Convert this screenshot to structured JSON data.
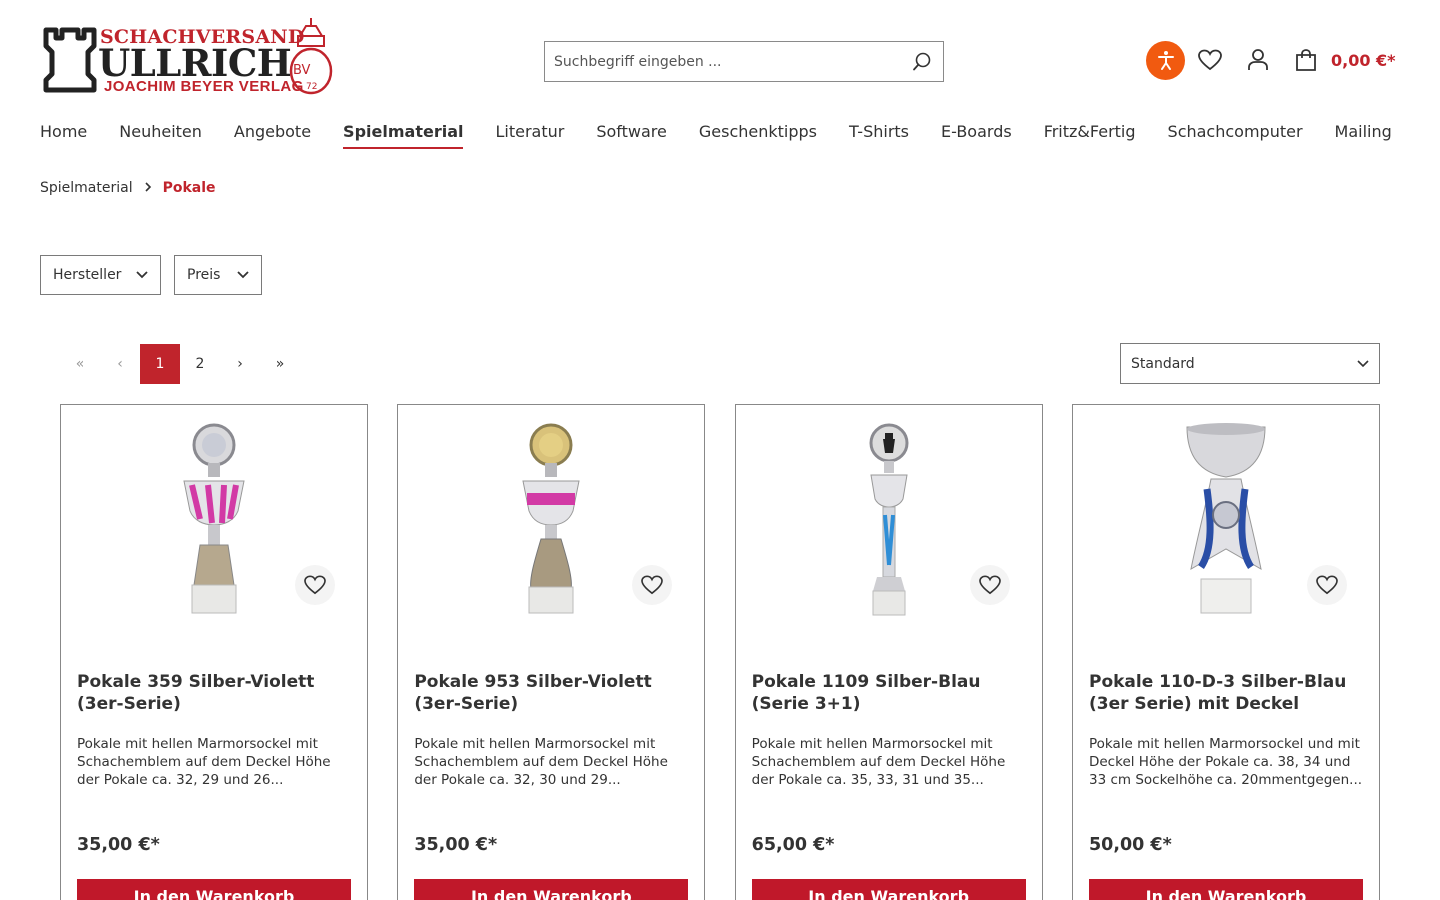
{
  "logo": {
    "top": "SCHACHVERSAND",
    "main": "ULLRICH",
    "sub": "JOACHIM BEYER VERLAG",
    "seal_text": "BV",
    "seal_year": "72"
  },
  "search": {
    "placeholder": "Suchbegriff eingeben ..."
  },
  "header_actions": {
    "accessibility_icon": "accessibility-icon",
    "wishlist_icon": "heart-icon",
    "account_icon": "user-icon",
    "cart_icon": "shopping-bag-icon",
    "cart_total": "0,00 €*"
  },
  "nav": {
    "items": [
      {
        "label": "Home"
      },
      {
        "label": "Neuheiten"
      },
      {
        "label": "Angebote"
      },
      {
        "label": "Spielmaterial",
        "active": true
      },
      {
        "label": "Literatur"
      },
      {
        "label": "Software"
      },
      {
        "label": "Geschenktipps"
      },
      {
        "label": "T-Shirts"
      },
      {
        "label": "E-Boards"
      },
      {
        "label": "Fritz&Fertig"
      },
      {
        "label": "Schachcomputer"
      },
      {
        "label": "Mailing"
      }
    ]
  },
  "breadcrumb": {
    "parent": "Spielmaterial",
    "current": "Pokale"
  },
  "filters": {
    "manufacturer": "Hersteller",
    "price": "Preis"
  },
  "pagination": {
    "first": "«",
    "prev": "‹",
    "pages": [
      "1",
      "2"
    ],
    "current_page": "1",
    "next": "›",
    "last": "»"
  },
  "sort": {
    "selected": "Standard"
  },
  "colors": {
    "brand_red": "#c0242c",
    "buy_button": "#c0182a",
    "accessibility_orange": "#f15a10"
  },
  "products": [
    {
      "title": "Pokale 359 Silber-Violett (3er-Serie)",
      "description": "Pokale mit hellen Marmorsockel mit Schachemblem auf dem Deckel Höhe der Pokale ca. 32, 29 und 26...",
      "price": "35,00 €*",
      "button": "In den Warenkorb"
    },
    {
      "title": "Pokale 953 Silber-Violett (3er-Serie)",
      "description": "Pokale mit hellen Marmorsockel mit Schachemblem auf dem Deckel Höhe der Pokale ca. 32, 30 und 29...",
      "price": "35,00 €*",
      "button": "In den Warenkorb"
    },
    {
      "title": "Pokale 1109 Silber-Blau (Serie 3+1)",
      "description": "Pokale mit hellen Marmorsockel mit Schachemblem auf dem Deckel Höhe der Pokale ca. 35, 33, 31 und 35...",
      "price": "65,00 €*",
      "button": "In den Warenkorb"
    },
    {
      "title": "Pokale 110-D-3 Silber-Blau (3er Serie) mit Deckel",
      "description": "Pokale mit hellen Marmorsockel und mit Deckel Höhe der Pokale ca. 38, 34 und 33 cm Sockelhöhe ca. 20mmentgegen...",
      "price": "50,00 €*",
      "button": "In den Warenkorb"
    }
  ]
}
